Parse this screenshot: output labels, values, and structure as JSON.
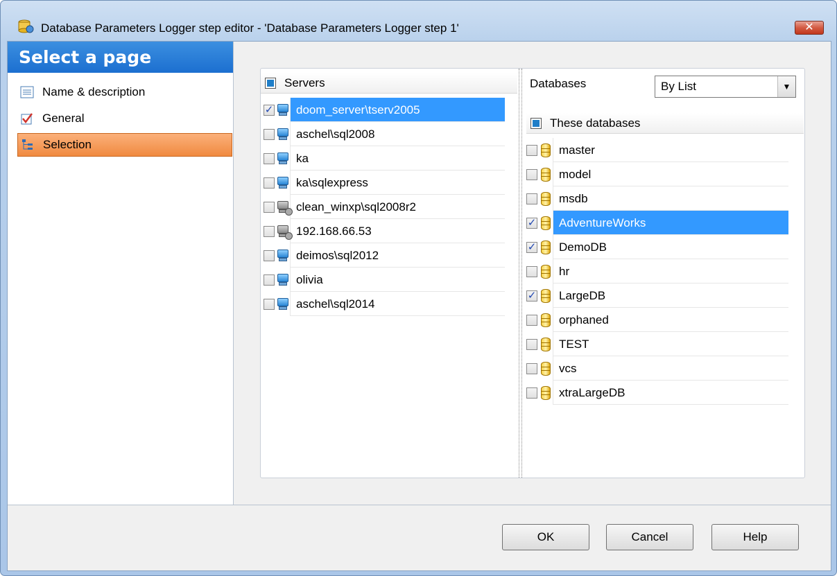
{
  "window": {
    "title": "Database Parameters Logger step editor - 'Database Parameters Logger step 1'",
    "close_glyph": "✕"
  },
  "sidebar": {
    "header": "Select a page",
    "items": [
      {
        "label": "Name & description",
        "icon": "list-icon",
        "active": false
      },
      {
        "label": "General",
        "icon": "checkbox-icon",
        "active": false
      },
      {
        "label": "Selection",
        "icon": "tree-icon",
        "active": true
      }
    ]
  },
  "servers": {
    "header": "Servers",
    "items": [
      {
        "name": "doom_server\\tserv2005",
        "checked": true,
        "selected": true,
        "icon": "server-online-icon"
      },
      {
        "name": "aschel\\sql2008",
        "checked": false,
        "selected": false,
        "icon": "server-online-icon"
      },
      {
        "name": "ka",
        "checked": false,
        "selected": false,
        "icon": "server-online-icon"
      },
      {
        "name": "ka\\sqlexpress",
        "checked": false,
        "selected": false,
        "icon": "server-online-icon"
      },
      {
        "name": "clean_winxp\\sql2008r2",
        "checked": false,
        "selected": false,
        "icon": "server-offline-icon"
      },
      {
        "name": "192.168.66.53",
        "checked": false,
        "selected": false,
        "icon": "server-offline-icon"
      },
      {
        "name": "deimos\\sql2012",
        "checked": false,
        "selected": false,
        "icon": "server-online-icon"
      },
      {
        "name": "olivia",
        "checked": false,
        "selected": false,
        "icon": "server-online-icon"
      },
      {
        "name": "aschel\\sql2014",
        "checked": false,
        "selected": false,
        "icon": "server-online-icon"
      }
    ]
  },
  "databases": {
    "filter_label": "Databases",
    "filter_value": "By List",
    "header": "These databases",
    "items": [
      {
        "name": "master",
        "checked": false,
        "selected": false
      },
      {
        "name": "model",
        "checked": false,
        "selected": false
      },
      {
        "name": "msdb",
        "checked": false,
        "selected": false
      },
      {
        "name": "AdventureWorks",
        "checked": true,
        "selected": true
      },
      {
        "name": "DemoDB",
        "checked": true,
        "selected": false
      },
      {
        "name": "hr",
        "checked": false,
        "selected": false
      },
      {
        "name": "LargeDB",
        "checked": true,
        "selected": false
      },
      {
        "name": "orphaned",
        "checked": false,
        "selected": false
      },
      {
        "name": "TEST",
        "checked": false,
        "selected": false
      },
      {
        "name": "vcs",
        "checked": false,
        "selected": false
      },
      {
        "name": "xtraLargeDB",
        "checked": false,
        "selected": false
      }
    ]
  },
  "buttons": {
    "ok": "OK",
    "cancel": "Cancel",
    "help": "Help"
  },
  "colors": {
    "selection": "#3399ff",
    "active_page": "#f08a40",
    "header_blue": "#1c6fd0"
  }
}
